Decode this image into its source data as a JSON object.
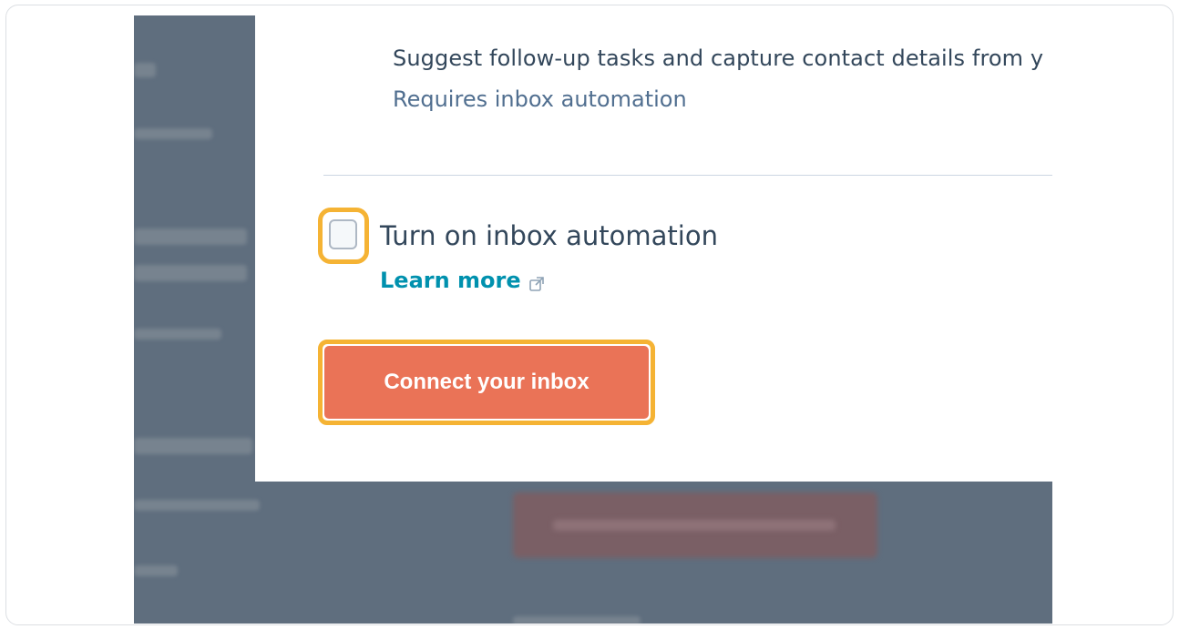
{
  "modal": {
    "description": "Suggest follow-up tasks and capture contact details from y",
    "requirement": "Requires inbox automation",
    "toggle_label": "Turn on inbox automation",
    "learn_more": "Learn more",
    "connect_button": "Connect your inbox",
    "checkbox_checked": false
  },
  "icons": {
    "learn_more_icon": "external-link-icon"
  },
  "colors": {
    "accent": "#ea7357",
    "link": "#0091ae",
    "focus_ring": "#f5b334",
    "overlay": "#5f6e7e",
    "text": "#33475b"
  }
}
